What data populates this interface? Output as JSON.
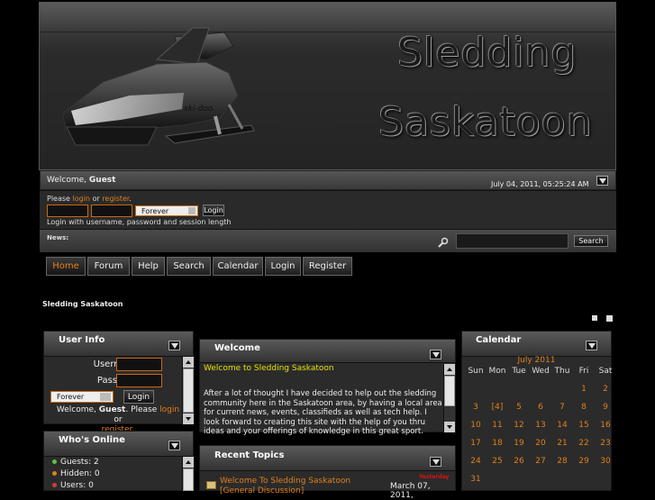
{
  "header": {
    "logo_line1": "Sledding",
    "logo_line2": "Saskatoon",
    "sled_brand": "ski-doo"
  },
  "welcome": {
    "prefix": "Welcome,",
    "user": "Guest",
    "datetime": "July 04, 2011, 05:25:24 AM"
  },
  "login": {
    "please": "Please",
    "login_link": "login",
    "or": "or",
    "register_link": "register",
    "session_select": "Forever",
    "login_button": "Login",
    "hint": "Login with username, password and session length"
  },
  "news": {
    "label": "News:",
    "search_button": "Search"
  },
  "menu": [
    "Home",
    "Forum",
    "Help",
    "Search",
    "Calendar",
    "Login",
    "Register"
  ],
  "breadcrumb": "Sledding Saskatoon",
  "userinfo": {
    "title": "User Info",
    "username_label": "Username:",
    "password_label": "Password:",
    "session_select": "Forever",
    "login_button": "Login",
    "welcome_prefix": "Welcome,",
    "user": "Guest",
    "please": ". Please",
    "login_link": "login",
    "or": "or",
    "register_link": "register",
    "period": "."
  },
  "whos_online": {
    "title": "Who's Online",
    "items": [
      "Guests: 2",
      "Hidden: 0",
      "Users: 0"
    ],
    "dot_colors": [
      "#5fbf3f",
      "#e0801a",
      "#d63a3a"
    ]
  },
  "welcome_panel": {
    "title": "Welcome",
    "heading": "Welcome to Sledding Saskatoon",
    "body": "After a lot of thought I have decided to help out the sledding community here in the Saskatoon area, by having a local area for current news, events, classifieds as well as tech help. I look forward to creating this site with the help of you thru ideas and your offerings of knowledge in this great sport."
  },
  "recent_topics": {
    "title": "Recent Topics",
    "topic": "Welcome To Sledding Saskatoon",
    "board": "[General Discussion]",
    "badge": "Yesterday",
    "date": "March 07, 2011,"
  },
  "calendar": {
    "title": "Calendar",
    "month": "July 2011",
    "weekdays": [
      "Sun",
      "Mon",
      "Tue",
      "Wed",
      "Thu",
      "Fri",
      "Sat"
    ],
    "weeks": [
      [
        "",
        "",
        "",
        "",
        "",
        "1",
        "2"
      ],
      [
        "3",
        "[4]",
        "5",
        "6",
        "7",
        "8",
        "9"
      ],
      [
        "10",
        "11",
        "12",
        "13",
        "14",
        "15",
        "16"
      ],
      [
        "17",
        "18",
        "19",
        "20",
        "21",
        "22",
        "23"
      ],
      [
        "24",
        "25",
        "26",
        "27",
        "28",
        "29",
        "30"
      ],
      [
        "31",
        "",
        "",
        "",
        "",
        "",
        ""
      ]
    ]
  }
}
